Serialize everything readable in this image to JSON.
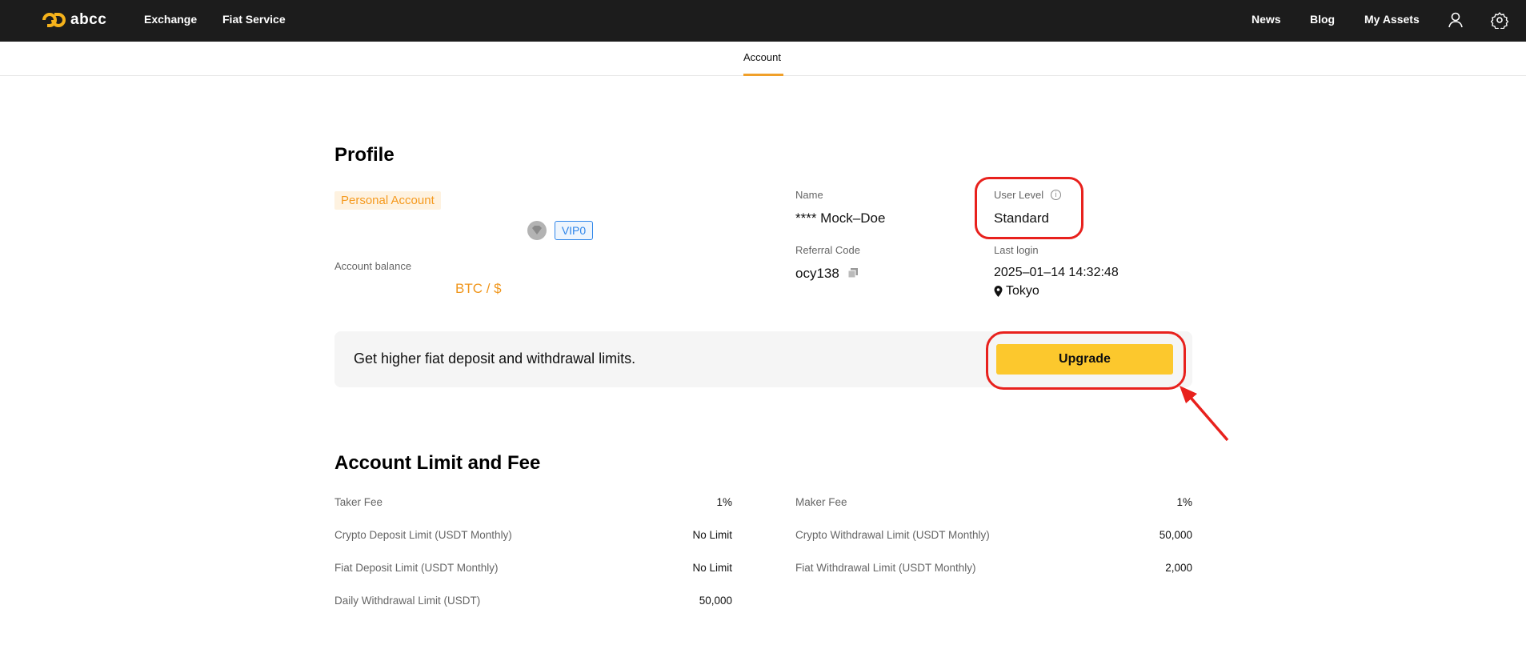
{
  "brand": {
    "name": "abcc",
    "accent": "#f5b21b"
  },
  "nav": {
    "left": [
      "Exchange",
      "Fiat Service"
    ],
    "right": [
      "News",
      "Blog",
      "My Assets"
    ],
    "icons": [
      "user-icon",
      "gear-icon"
    ]
  },
  "subnav": {
    "active_tab": "Account"
  },
  "profile": {
    "title": "Profile",
    "account_type": "Personal Account",
    "vip": "VIP0",
    "balance_label": "Account balance",
    "balance_value": "BTC / $",
    "name_label": "Name",
    "name_value": "**** Mock–Doe",
    "user_level_label": "User Level",
    "user_level_value": "Standard",
    "referral_label": "Referral Code",
    "referral_value": "ocy138",
    "last_login_label": "Last login",
    "last_login_value": "2025–01–14 14:32:48",
    "location": "Tokyo"
  },
  "upgrade": {
    "message": "Get higher fiat deposit and withdrawal limits.",
    "button_label": "Upgrade"
  },
  "limits": {
    "title": "Account Limit and Fee",
    "left": [
      {
        "label": "Taker Fee",
        "value": "1%"
      },
      {
        "label": "Crypto Deposit Limit (USDT Monthly)",
        "value": "No Limit"
      },
      {
        "label": "Fiat Deposit Limit (USDT Monthly)",
        "value": "No Limit"
      },
      {
        "label": "Daily Withdrawal Limit (USDT)",
        "value": "50,000"
      }
    ],
    "right": [
      {
        "label": "Maker Fee",
        "value": "1%"
      },
      {
        "label": "Crypto Withdrawal Limit (USDT Monthly)",
        "value": "50,000"
      },
      {
        "label": "Fiat Withdrawal Limit (USDT Monthly)",
        "value": "2,000"
      }
    ]
  },
  "colors": {
    "annotation": "#e8211d",
    "button": "#fcc82d",
    "balance": "#f0961c",
    "vip": "#2f86ea"
  }
}
